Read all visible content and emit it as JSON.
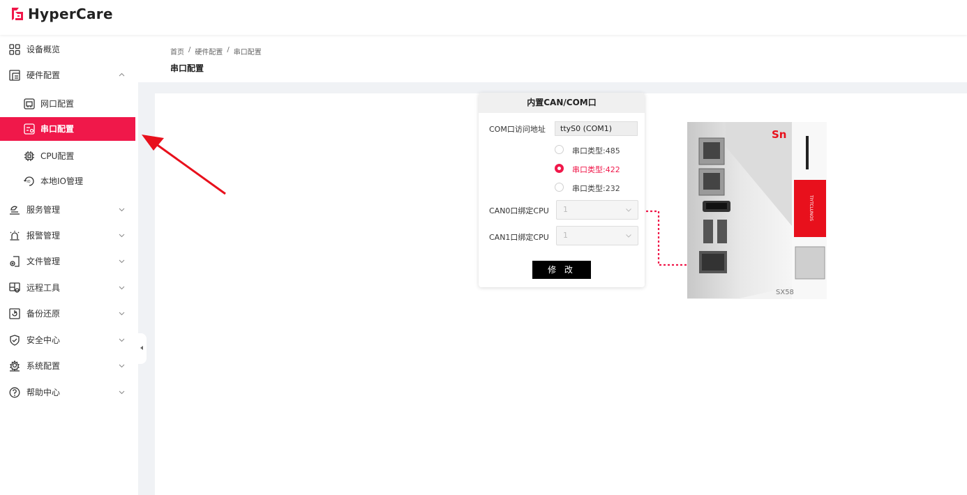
{
  "app": {
    "title": "HyperCare"
  },
  "sidebar": {
    "items": [
      {
        "label": "设备概览",
        "icon": "grid-icon"
      },
      {
        "label": "硬件配置",
        "icon": "hardware-icon"
      },
      {
        "label": "网口配置",
        "icon": "network-port-icon"
      },
      {
        "label": "串口配置",
        "icon": "serial-port-icon"
      },
      {
        "label": "CPU配置",
        "icon": "cpu-icon"
      },
      {
        "label": "本地IO管理",
        "icon": "io-icon"
      },
      {
        "label": "服务管理",
        "icon": "service-icon"
      },
      {
        "label": "报警管理",
        "icon": "alarm-icon"
      },
      {
        "label": "文件管理",
        "icon": "file-icon"
      },
      {
        "label": "远程工具",
        "icon": "remote-tool-icon"
      },
      {
        "label": "备份还原",
        "icon": "backup-icon"
      },
      {
        "label": "安全中心",
        "icon": "shield-icon"
      },
      {
        "label": "系统配置",
        "icon": "system-config-icon"
      },
      {
        "label": "帮助中心",
        "icon": "help-icon"
      }
    ]
  },
  "breadcrumb": {
    "items": [
      "首页",
      "/",
      "硬件配置",
      "/",
      "串口配置"
    ]
  },
  "page": {
    "title": "串口配置"
  },
  "panel": {
    "title": "内置CAN/COM口",
    "com_label": "COM口访问地址",
    "com_value": "ttyS0 (COM1)",
    "radios": [
      {
        "label": "串口类型:485",
        "checked": false
      },
      {
        "label": "串口类型:422",
        "checked": true
      },
      {
        "label": "串口类型:232",
        "checked": false
      }
    ],
    "can0_label": "CAN0口绑定CPU",
    "can0_value": "1",
    "can1_label": "CAN1口绑定CPU",
    "can1_value": "1",
    "modify_label": "修 改"
  },
  "device": {
    "brand": "Sn",
    "model": "SX58",
    "side_text": "TIYTCLUNOS"
  },
  "colors": {
    "accent": "#f0184a"
  }
}
